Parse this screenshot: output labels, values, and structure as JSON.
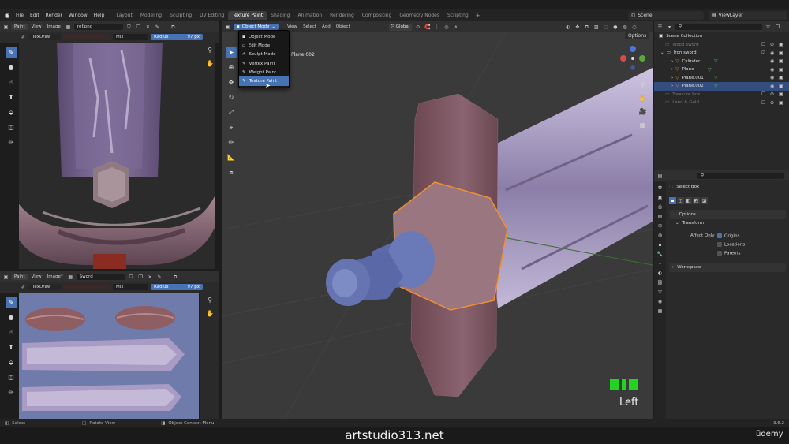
{
  "menubar": {
    "items": [
      "File",
      "Edit",
      "Render",
      "Window",
      "Help"
    ],
    "workspaces": [
      "Layout",
      "Modeling",
      "Sculpting",
      "UV Editing",
      "Texture Paint",
      "Shading",
      "Animation",
      "Rendering",
      "Compositing",
      "Geometry Nodes",
      "Scripting"
    ],
    "active_workspace": "Texture Paint",
    "scene": "Scene",
    "view_layer": "ViewLayer"
  },
  "image_editor_top": {
    "mode": "Paint",
    "view": "View",
    "image": "Image",
    "image_name": "ref.png",
    "brush": "TexDraw",
    "blend": "Mix",
    "radius_label": "Radius",
    "radius_value": "97 px"
  },
  "image_editor_bottom": {
    "mode": "Paint",
    "view": "View",
    "image": "Image*",
    "image_name": "Sword",
    "brush": "TexDraw",
    "blend": "Mix",
    "radius_label": "Radius",
    "radius_value": "97 px"
  },
  "viewport": {
    "mode_button": "Object Mode",
    "menus": [
      "View",
      "Select",
      "Add",
      "Object"
    ],
    "transform_orientation": "Global",
    "options": "Options",
    "active_object": "Plane.002",
    "view_name": "Left",
    "mode_menu": [
      {
        "label": "Object Mode",
        "icon": "object-mode-icon",
        "active": false
      },
      {
        "label": "Edit Mode",
        "icon": "edit-mode-icon",
        "active": false
      },
      {
        "label": "Sculpt Mode",
        "icon": "sculpt-mode-icon",
        "active": false
      },
      {
        "label": "Vertex Paint",
        "icon": "vertex-paint-icon",
        "active": false
      },
      {
        "label": "Weight Paint",
        "icon": "weight-paint-icon",
        "active": false
      },
      {
        "label": "Texture Paint",
        "icon": "texture-paint-icon",
        "active": true
      }
    ]
  },
  "outliner": {
    "rows": [
      {
        "label": "Scene Collection",
        "depth": 0,
        "state": "normal"
      },
      {
        "label": "Wood sword",
        "depth": 1,
        "state": "dim"
      },
      {
        "label": "Iron sword",
        "depth": 1,
        "state": "normal"
      },
      {
        "label": "Cylinder",
        "depth": 2,
        "state": "normal"
      },
      {
        "label": "Plane",
        "depth": 2,
        "state": "normal"
      },
      {
        "label": "Plane.001",
        "depth": 2,
        "state": "normal"
      },
      {
        "label": "Plane.002",
        "depth": 2,
        "state": "selected"
      },
      {
        "label": "Treasure box",
        "depth": 1,
        "state": "dim"
      },
      {
        "label": "Land & Gold",
        "depth": 1,
        "state": "dim"
      }
    ]
  },
  "properties": {
    "tool_name": "Select Box",
    "options": "Options",
    "transform": "Transform",
    "affect_only": "Affect Only",
    "origins": "Origins",
    "locations": "Locations",
    "parents": "Parents",
    "workspace": "Workspace",
    "colors": {
      "accent": "#4772b3"
    }
  },
  "statusbar": {
    "select": "Select",
    "rotate_view": "Rotate View",
    "context_menu": "Object Context Menu",
    "version": "3.6.2"
  },
  "watermark": "artstudio313.net",
  "brand": "ūdemy"
}
